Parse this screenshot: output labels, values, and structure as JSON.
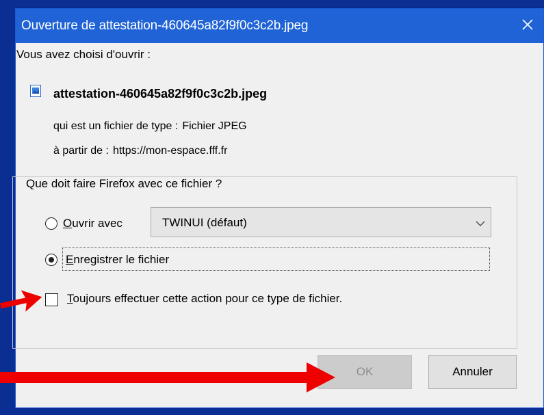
{
  "dialog": {
    "title": "Ouverture de attestation-460645a82f9f0c3c2b.jpeg",
    "intro": "Vous avez choisi d'ouvrir :",
    "file_name": "attestation-460645a82f9f0c3c2b.jpeg",
    "type_label": "qui est un fichier de type :",
    "type_value": "Fichier JPEG",
    "from_label": "à partir de :",
    "from_value": "https://mon-espace.fff.fr",
    "question": "Que doit faire Firefox avec ce fichier ?",
    "open_with": {
      "accel": "O",
      "rest": "uvrir avec",
      "selected": false
    },
    "app_select": {
      "value": "TWINUI (défaut)"
    },
    "save_file": {
      "accel": "E",
      "rest": "nregistrer le fichier",
      "selected": true
    },
    "always": {
      "accel": "T",
      "rest": "oujours effectuer cette action pour ce type de fichier.",
      "checked": false
    },
    "ok_label": "OK",
    "cancel_label": "Annuler"
  },
  "colors": {
    "titlebar": "#1f63d6",
    "desktop": "#0a2a8c",
    "annotation_arrow": "#ee0000"
  },
  "icons": [
    "close-icon",
    "image-file-icon",
    "chevron-down-icon",
    "red-arrow-icon"
  ]
}
